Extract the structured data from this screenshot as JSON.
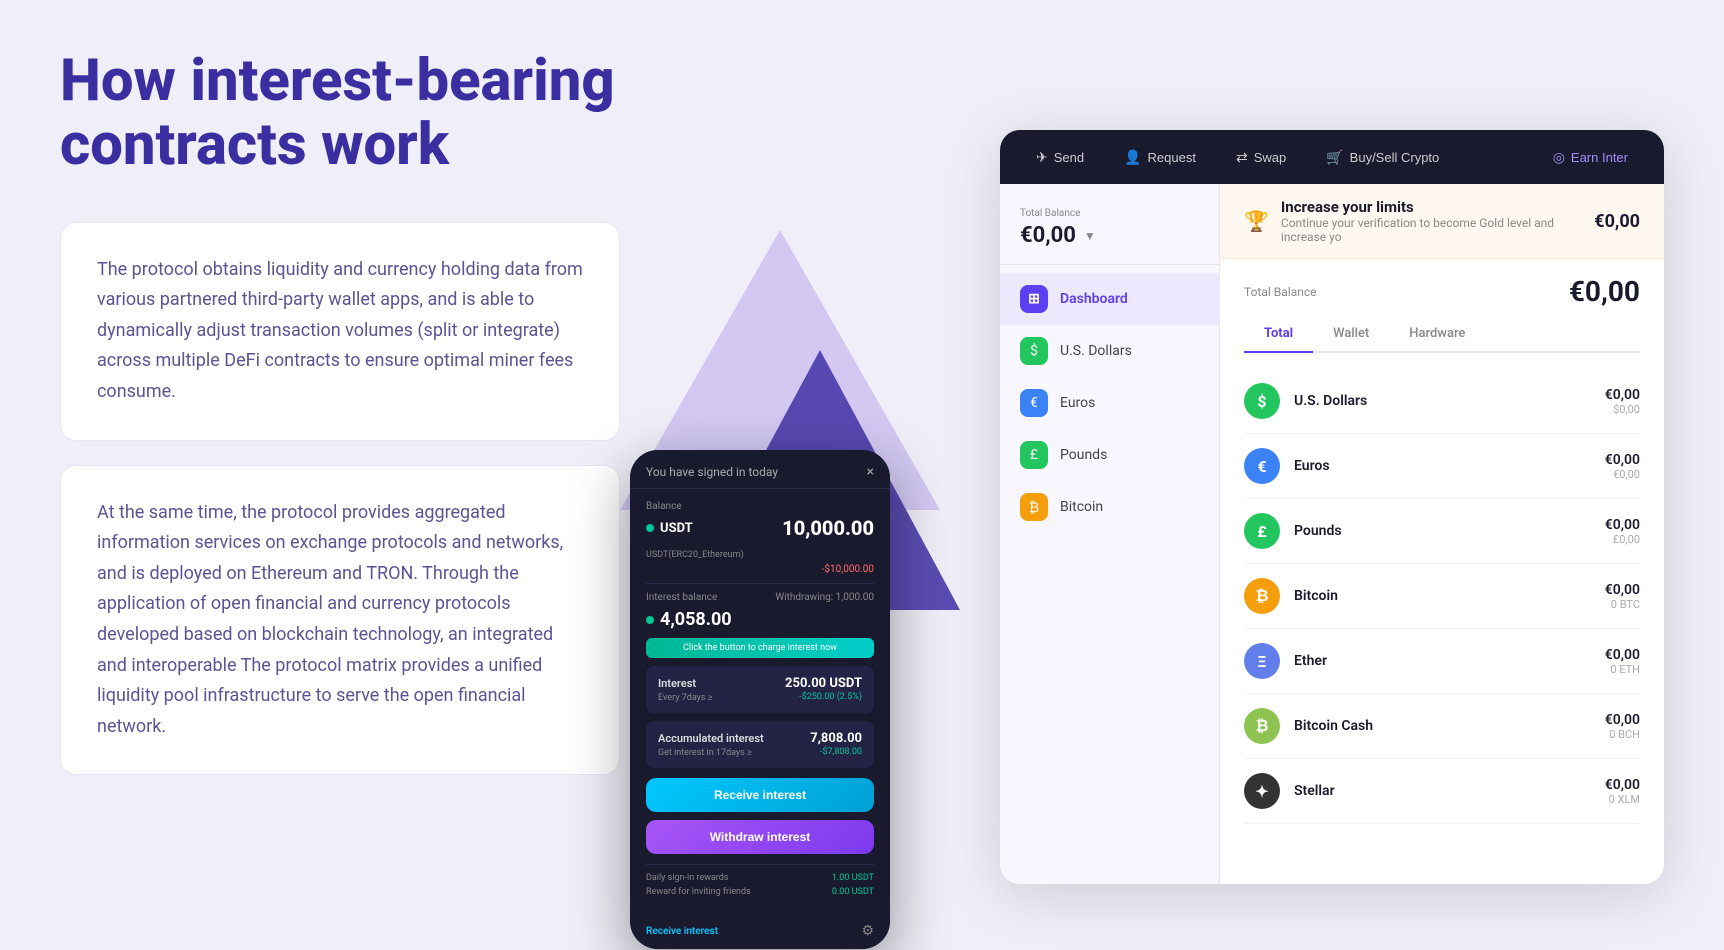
{
  "page": {
    "title": "How interest-bearing contracts work",
    "title_line1": "How interest-bearing",
    "title_line2": "contracts work"
  },
  "info_cards": [
    {
      "id": "card1",
      "text": "The protocol obtains liquidity and currency holding data from various partnered third-party wallet apps, and is able to dynamically adjust transaction volumes (split or integrate) across multiple DeFi contracts to ensure optimal miner fees consume."
    },
    {
      "id": "card2",
      "text": "At the same time, the protocol provides aggregated information services on exchange protocols and networks, and is deployed on Ethereum and TRON. Through the application of open financial and currency protocols developed based on blockchain technology, an integrated and interoperable The protocol matrix provides a unified liquidity pool infrastructure to serve the open financial network."
    }
  ],
  "phone": {
    "header_title": "You have signed in today",
    "close_icon": "×",
    "balance_label": "Balance",
    "coin_name": "USDT",
    "coin_amount": "10,000.00",
    "coin_sub": "USDT(ERC20_Ethereum)",
    "coin_neg": "-$10,000.00",
    "interest_balance_label": "Interest balance",
    "withdrawing_label": "Withdrawing: 1,000.00",
    "interest_amount": "4,058.00",
    "click_banner": "Click the button to charge interest now",
    "interest_label": "Interest",
    "interest_val": "250.00 USDT",
    "interest_period": "Every 7days ≥",
    "interest_neg": "-$250.00 (2.5%)",
    "accumulated_label": "Accumulated interest",
    "accumulated_val": "7,808.00",
    "accumulated_sub": "Get interest in 17days ≥",
    "accumulated_neg": "-$7,808.00",
    "btn_receive": "Receive interest",
    "btn_withdraw": "Withdraw interest",
    "reward1_label": "Daily sign-in rewards",
    "reward1_val": "1.00 USDT",
    "reward2_label": "Reward for inviting friends",
    "reward2_val": "0.00 USDT",
    "bottom_btn": "Receive interest",
    "bottom_icon": "⚙"
  },
  "dashboard": {
    "nav": {
      "send_label": "Send",
      "request_label": "Request",
      "swap_label": "Swap",
      "buy_sell_label": "Buy/Sell Crypto",
      "earn_label": "Earn Inter"
    },
    "notification": {
      "title": "Increase your limits",
      "subtitle": "Continue your verification to become Gold level and increase yo",
      "amount": "€0,00"
    },
    "total_balance_label": "Total Balance",
    "total_balance": "€0,00",
    "balance_section_label": "Total Balance",
    "balance_amount": "€0,00",
    "tabs": [
      "Total",
      "Wallet",
      "Hardware"
    ],
    "active_tab": "Total",
    "sidebar_items": [
      {
        "id": "dashboard",
        "label": "Dashboard",
        "icon": "⊞",
        "active": true
      },
      {
        "id": "usd",
        "label": "U.S. Dollars",
        "icon": "$",
        "active": false
      },
      {
        "id": "eur",
        "label": "Euros",
        "icon": "€",
        "active": false
      },
      {
        "id": "gbp",
        "label": "Pounds",
        "icon": "£",
        "active": false
      },
      {
        "id": "btc",
        "label": "Bitcoin",
        "icon": "₿",
        "active": false
      }
    ],
    "crypto_list": [
      {
        "id": "usd",
        "name": "U.S. Dollars",
        "icon": "$",
        "icon_class": "ci-usd",
        "fiat": "€0,00",
        "coin": "$0,00"
      },
      {
        "id": "eur",
        "name": "Euros",
        "icon": "€",
        "icon_class": "ci-eur",
        "fiat": "€0,00",
        "coin": "€0,00"
      },
      {
        "id": "gbp",
        "name": "Pounds",
        "icon": "£",
        "icon_class": "ci-gbp",
        "fiat": "€0,00",
        "coin": "£0,00"
      },
      {
        "id": "btc",
        "name": "Bitcoin",
        "icon": "₿",
        "icon_class": "ci-btc",
        "fiat": "€0,00",
        "coin": "0 BTC"
      },
      {
        "id": "eth",
        "name": "Ether",
        "icon": "Ξ",
        "icon_class": "ci-eth",
        "fiat": "€0,00",
        "coin": "0 ETH"
      },
      {
        "id": "bch",
        "name": "Bitcoin Cash",
        "icon": "₿",
        "icon_class": "ci-bch",
        "fiat": "€0,00",
        "coin": "0 BCH"
      },
      {
        "id": "xlm",
        "name": "Stellar",
        "icon": "✦",
        "icon_class": "ci-xlm",
        "fiat": "€0,00",
        "coin": "0 XLM"
      }
    ]
  },
  "colors": {
    "accent": "#5b3ff0",
    "bg": "#f0eef8",
    "dark": "#1a1a2e",
    "green": "#22c55e",
    "purple": "#a855f7"
  }
}
